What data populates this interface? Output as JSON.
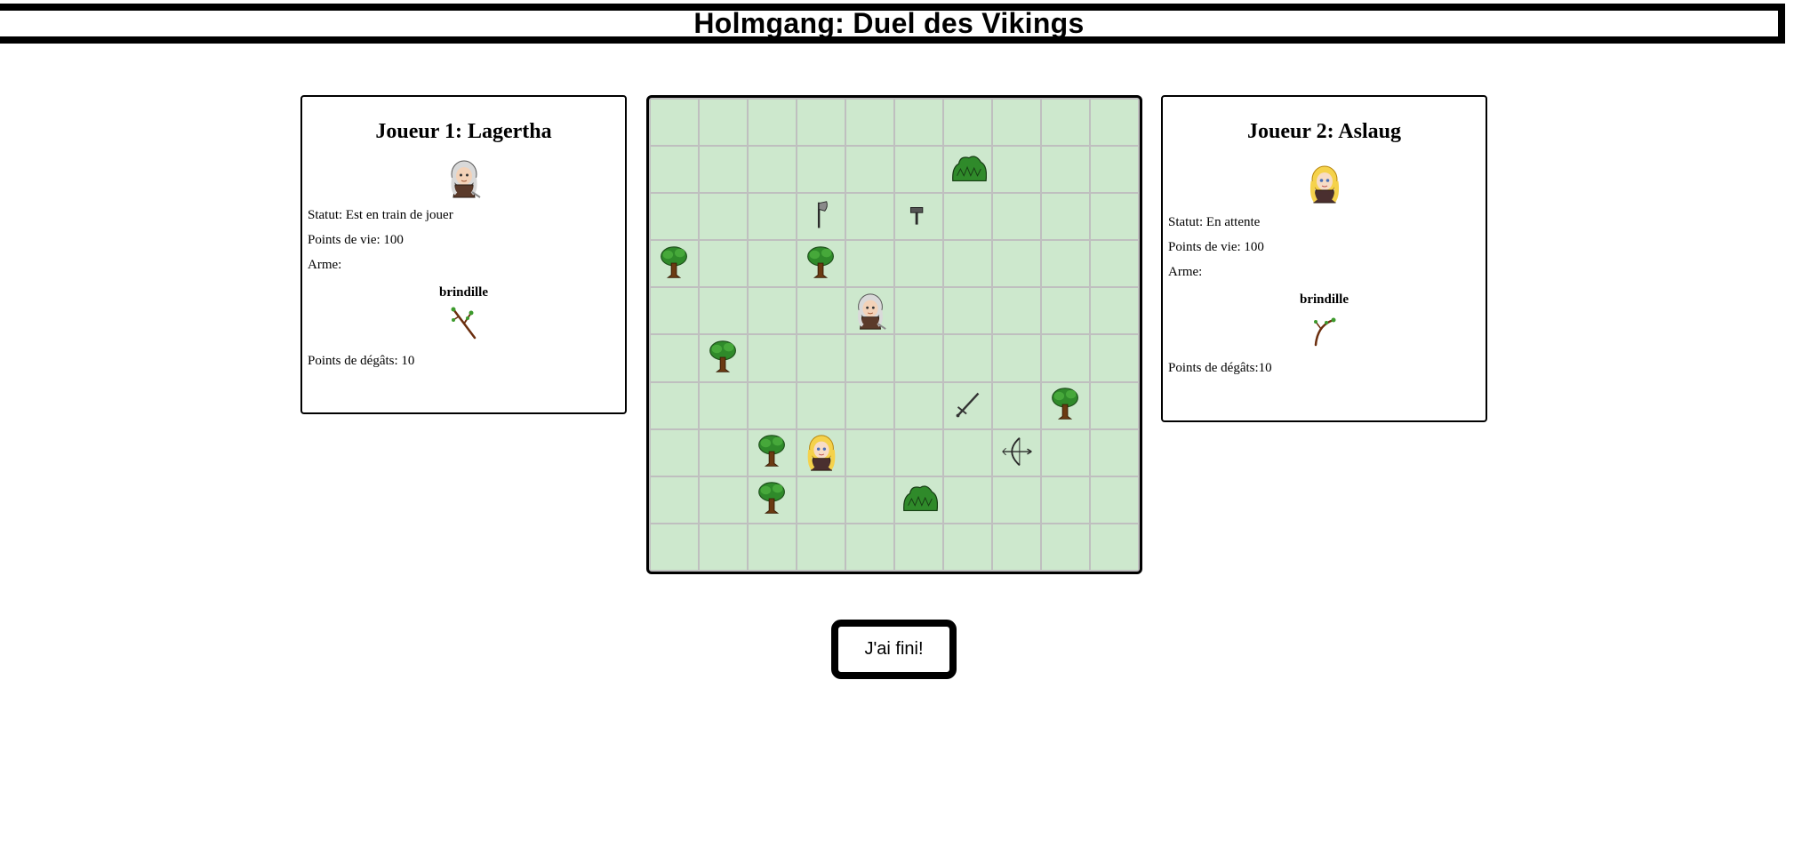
{
  "page": {
    "title": "Holmgang: Duel des Vikings"
  },
  "players": [
    {
      "id": "p1",
      "heading": "Joueur 1: Lagertha",
      "avatar_icon": "viking-white-hair",
      "status": "Statut: Est en train de jouer",
      "health": "Points de vie: 100",
      "weapon_label": "Arme:",
      "weapon_name": "brindille",
      "weapon_icon": "twig",
      "damage": "Points de dégâts: 10"
    },
    {
      "id": "p2",
      "heading": "Joueur 2: Aslaug",
      "avatar_icon": "viking-blonde",
      "status": "Statut: En attente",
      "health": "Points de vie: 100",
      "weapon_label": "Arme:",
      "weapon_name": "brindille",
      "weapon_icon": "twig",
      "damage": "Points de dégâts:10"
    }
  ],
  "board": {
    "rows": 10,
    "cols": 10,
    "cell_color": "#cde8cd",
    "items": [
      {
        "row": 1,
        "col": 6,
        "type": "bush"
      },
      {
        "row": 2,
        "col": 3,
        "type": "axe"
      },
      {
        "row": 2,
        "col": 5,
        "type": "hammer"
      },
      {
        "row": 3,
        "col": 0,
        "type": "tree"
      },
      {
        "row": 3,
        "col": 3,
        "type": "tree"
      },
      {
        "row": 4,
        "col": 4,
        "type": "player1"
      },
      {
        "row": 5,
        "col": 1,
        "type": "tree"
      },
      {
        "row": 6,
        "col": 6,
        "type": "sword"
      },
      {
        "row": 6,
        "col": 8,
        "type": "tree"
      },
      {
        "row": 7,
        "col": 2,
        "type": "tree"
      },
      {
        "row": 7,
        "col": 3,
        "type": "player2"
      },
      {
        "row": 7,
        "col": 7,
        "type": "bow"
      },
      {
        "row": 8,
        "col": 2,
        "type": "tree"
      },
      {
        "row": 8,
        "col": 5,
        "type": "bush"
      }
    ]
  },
  "actions": {
    "end_turn_label": "J'ai fini!"
  }
}
